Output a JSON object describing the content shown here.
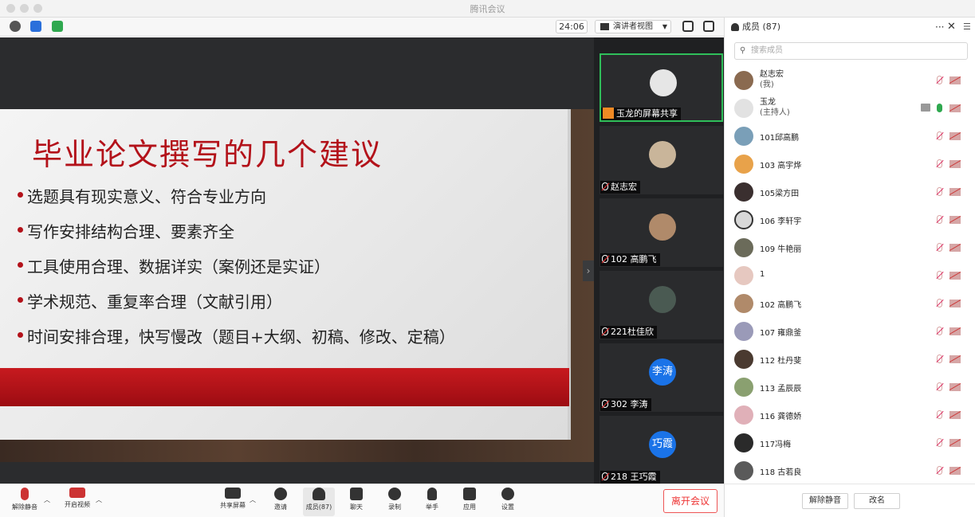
{
  "window": {
    "title": "腾讯会议"
  },
  "topbar": {
    "timer": "24:06",
    "view_label": "演讲者视图"
  },
  "slide": {
    "title": "毕业论文撰写的几个建议",
    "bullets": [
      "选题具有现实意义、符合专业方向",
      "写作安排结构合理、要素齐全",
      "工具使用合理、数据详实（案例还是实证）",
      "学术规范、重复率合理（文献引用）",
      "时间安排合理，快写慢改（题目+大纲、初稿、修改、定稿）"
    ]
  },
  "thumbs": [
    {
      "label": "玉龙的屏幕共享",
      "avatar_text": "",
      "active": true
    },
    {
      "label": "赵志宏",
      "avatar_text": ""
    },
    {
      "label": "102 高鹏飞",
      "avatar_text": ""
    },
    {
      "label": "221杜佳欣",
      "avatar_text": ""
    },
    {
      "label": "302 李涛",
      "avatar_text": "李涛"
    },
    {
      "label": "218 王巧霞",
      "avatar_text": "巧霞"
    }
  ],
  "panel": {
    "title": "成员 (87)",
    "search_placeholder": "搜索成员",
    "members": [
      {
        "name": "赵志宏",
        "sub": "(我)"
      },
      {
        "name": "玉龙",
        "sub": "(主持人)"
      },
      {
        "name": "101邱高鹏"
      },
      {
        "name": "103 高宇烨"
      },
      {
        "name": "105梁方田"
      },
      {
        "name": "106 李轩宇"
      },
      {
        "name": "109 牛艳丽"
      },
      {
        "name": "1"
      },
      {
        "name": "102 高鹏飞"
      },
      {
        "name": "107 雍鼎釜"
      },
      {
        "name": "112 杜丹斐"
      },
      {
        "name": "113 孟辰辰"
      },
      {
        "name": "116 龚德娇"
      },
      {
        "name": "117冯梅"
      },
      {
        "name": "118 古若良"
      }
    ],
    "unmute_all": "解除静音",
    "rename": "改名"
  },
  "toolbar": {
    "unmute": "解除静音",
    "start_video": "开启视频",
    "share_screen": "共享屏幕",
    "invite": "邀请",
    "members": "成员(87)",
    "chat": "聊天",
    "record": "录制",
    "raise_hand": "举手",
    "apps": "应用",
    "settings": "设置",
    "leave": "离开会议"
  },
  "colors": {
    "accent_red": "#b3121a",
    "active_green": "#2fbf5a",
    "avatar_blue": "#1a73e8"
  }
}
